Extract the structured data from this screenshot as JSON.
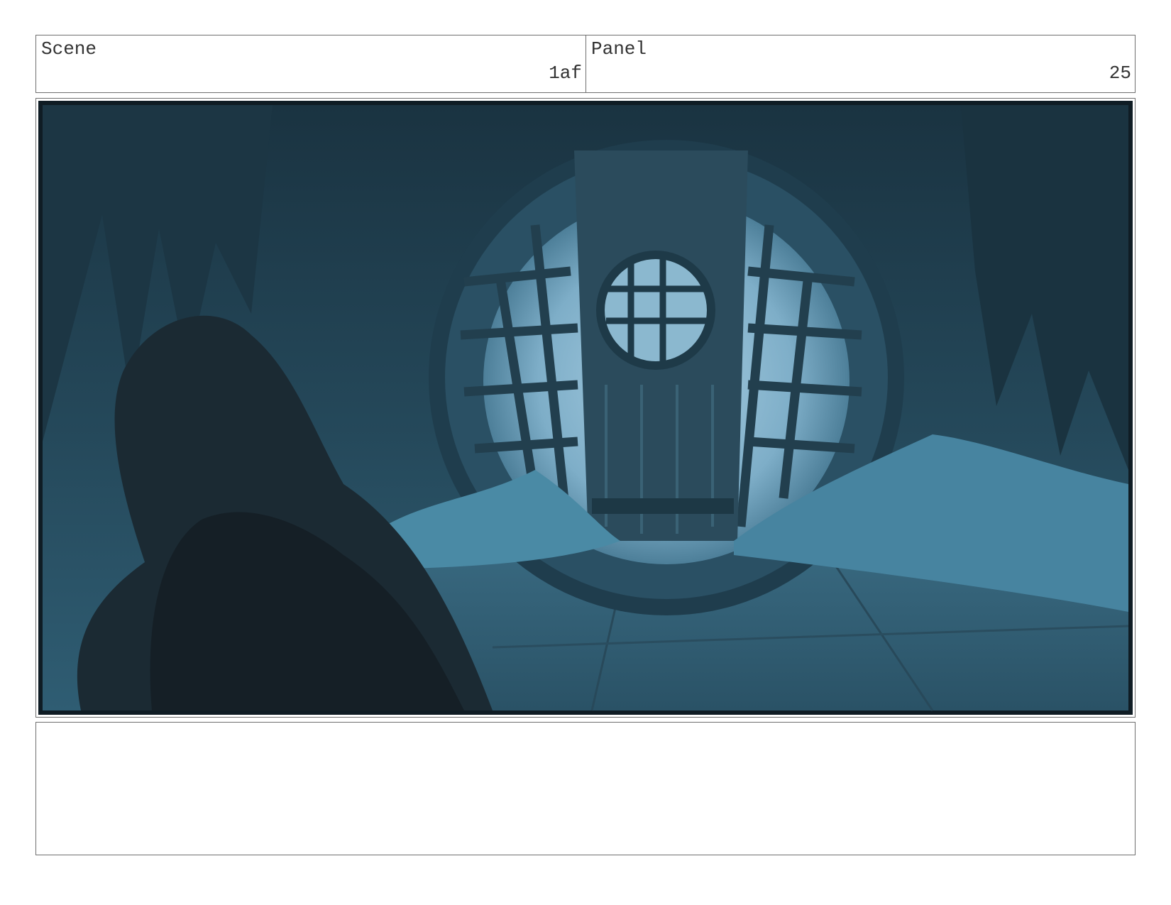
{
  "header": {
    "scene_label": "Scene",
    "scene_value": "1af",
    "panel_label": "Panel",
    "panel_value": "25"
  },
  "artwork": {
    "palette": {
      "dark": "#14232d",
      "mid": "#2c5468",
      "light": "#6d9fba",
      "glow": "#a7cde0"
    }
  },
  "notes": {
    "text": ""
  }
}
